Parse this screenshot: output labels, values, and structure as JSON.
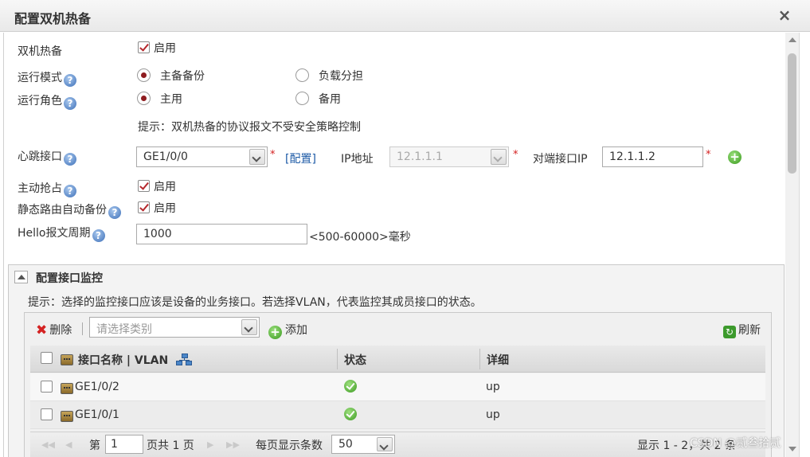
{
  "dialog": {
    "title": "配置双机热备",
    "close": "×"
  },
  "form": {
    "ha_label": "双机热备",
    "ha_enable": "启用",
    "mode_label": "运行模式",
    "mode_options": [
      "主备备份",
      "负载分担"
    ],
    "role_label": "运行角色",
    "role_options": [
      "主用",
      "备用"
    ],
    "hint": "提示：双机热备的协议报文不受安全策略控制",
    "hb_label": "心跳接口",
    "hb_value": "GE1/0/0",
    "config_link": "[配置]",
    "ip_label": "IP地址",
    "ip_value": "12.1.1.1",
    "peer_ip_label": "对端接口IP",
    "peer_ip_value": "12.1.1.2",
    "required_mark": "*",
    "preempt_label": "主动抢占",
    "preempt_enable": "启用",
    "static_route_label": "静态路由自动备份",
    "static_route_enable": "启用",
    "hello_label": "Hello报文周期",
    "hello_value": "1000",
    "hello_unit": "<500-60000>毫秒",
    "help_glyph": "?"
  },
  "monitor": {
    "title": "配置接口监控",
    "hint": "提示：选择的监控接口应该是设备的业务接口。若选择VLAN，代表监控其成员接口的状态。",
    "toolbar": {
      "delete": "删除",
      "category_placeholder": "请选择类别",
      "add": "添加",
      "refresh": "刷新"
    },
    "columns": [
      "接口名称 | VLAN",
      "状态",
      "详细"
    ],
    "rows": [
      {
        "name": "GE1/0/2",
        "status": "ok",
        "detail": "up"
      },
      {
        "name": "GE1/0/1",
        "status": "ok",
        "detail": "up"
      }
    ],
    "pager": {
      "page_prefix": "第",
      "page_value": "1",
      "page_suffix": "页共 1 页",
      "per_page_label": "每页显示条数",
      "per_page_value": "50",
      "summary": "显示 1 - 2，共 2 条"
    }
  },
  "watermark": "CSDN @贰叁拾贰"
}
